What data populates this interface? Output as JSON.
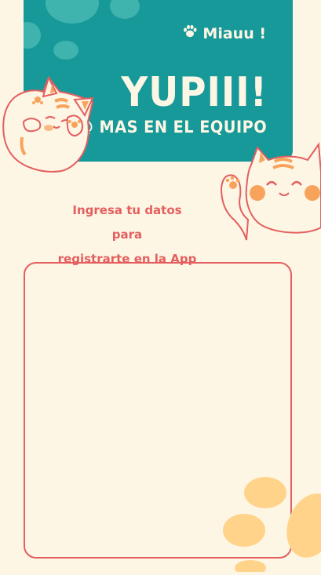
{
  "header": {
    "brand_label": "Miauu !",
    "title": "YUPIII!",
    "subtitle": "UN@ MAS EN EL EQUIPO"
  },
  "instructions": {
    "line1": "Ingresa tu datos para",
    "line2": "registrarte en la App"
  },
  "colors": {
    "background": "#fdf6e4",
    "header": "#17999a",
    "accent": "#e35f5f",
    "paw": "#ffd48a"
  },
  "icons": {
    "brand": "paw-icon",
    "cat_left": "cat-mascot-left",
    "cat_right": "cat-mascot-right",
    "deco": "paw-print-decoration"
  }
}
